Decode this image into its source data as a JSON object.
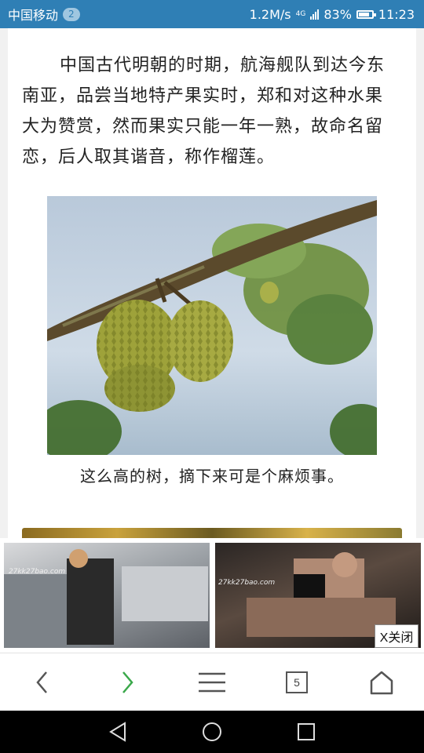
{
  "status_bar": {
    "carrier": "中国移动",
    "notification_count": "2",
    "net_speed": "1.2M/s",
    "network_type": "4G",
    "battery_percent": "83%",
    "battery_level": 0.83,
    "time": "11:23"
  },
  "article": {
    "paragraph": "中国古代明朝的时期，航海舰队到达今东南亚，品尝当地特产果实时，郑和对这种水果大为赞赏，然而果实只能一年一熟，故命名留恋，后人取其谐音，称作榴莲。",
    "caption": "这么高的树，摘下来可是个麻烦事。"
  },
  "ad": {
    "left_watermark": "27kk27bao.com",
    "right_watermark": "27kk27bao.com",
    "close_label": "X关闭"
  },
  "browser_toolbar": {
    "tab_count": "5"
  },
  "colors": {
    "status_bar": "#2f7fb5",
    "forward_arrow": "#3aa84a",
    "back_arrow": "#555555"
  },
  "icons": [
    "back-icon",
    "forward-icon",
    "menu-icon",
    "tabs-icon",
    "home-icon",
    "nav-back-icon",
    "nav-home-icon",
    "nav-recents-icon"
  ]
}
